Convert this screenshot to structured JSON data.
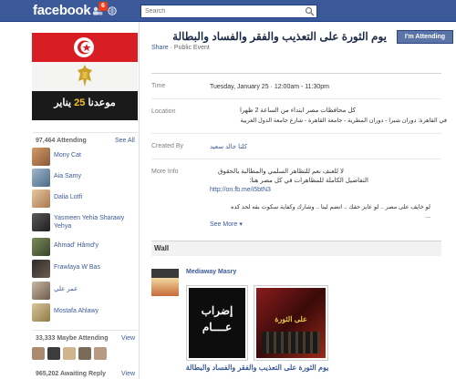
{
  "app": {
    "logo": "facebook"
  },
  "topbar": {
    "notification_count": "6",
    "search_placeholder": "Search",
    "icons": [
      "friends-icon",
      "globe-icon",
      "search-icon"
    ],
    "colors": {
      "bar": "#3b5998",
      "badge": "#f03d25"
    }
  },
  "banner": {
    "caption_prefix": "موعدنا ",
    "caption_number": "25",
    "caption_suffix": " يناير"
  },
  "sidebar": {
    "attending": {
      "header": "97,464 Attending",
      "see_all": "See All",
      "people": [
        {
          "name": "Mony Cat"
        },
        {
          "name": "Aia Samy"
        },
        {
          "name": "Dalia Lotfi"
        },
        {
          "name": "Yasmeen Yehia Sharawy Yehya"
        },
        {
          "name": "Ahmad' Hâmd'y"
        },
        {
          "name": "Frawlaya W Bas"
        },
        {
          "name": "عمر علي"
        },
        {
          "name": "Mostafa Ahlawy"
        }
      ]
    },
    "maybe": {
      "header": "33,333 Maybe Attending",
      "view": "View"
    },
    "awaiting": {
      "header": "965,202 Awaiting Reply",
      "view": "View"
    }
  },
  "event": {
    "title": "يوم الثورة على التعذيب والفقر والفساد والبطالة",
    "attend_button": "I'm Attending",
    "share": "Share",
    "separator": " · ",
    "visibility": "Public Event",
    "time_label": "Time",
    "time_value": "Tuesday, January 25 · 12:00am - 11:30pm",
    "location_label": "Location",
    "location_line1": "كل محافظات مصر ابتداء من الساعة 2 ظهرا",
    "location_line2": "في القاهرة: دوران شبرا - دوران المطرية - جامعة القاهرة - شارع جامعة الدول العربية",
    "created_label": "Created By",
    "created_value": "كلنا خالد سعيد",
    "info_label": "More Info",
    "info_line1": "لا للعنف نعم للتظاهر السلمي والمطالبة بالحقوق",
    "info_line2": "التفاصيل الكاملة للمظاهرات في كل مصر هنا:",
    "info_link": "http://on.fb.me/i5btN3",
    "info_line3": "لو خايف على مصر .. لو عايز حقك .. انضم لينا .. وشارك وكفاية سكوت بقه لحد كده",
    "info_line4": "...",
    "see_more": "See More"
  },
  "wall": {
    "header": "Wall",
    "poster": "Mediaway Masry",
    "photo1_line1": "إضراب",
    "photo1_line2": "عــــام",
    "photo2_text": "على الثورة",
    "post_title": "يوم الثورة على التعذيب والفقر والفساد والبطالة"
  }
}
